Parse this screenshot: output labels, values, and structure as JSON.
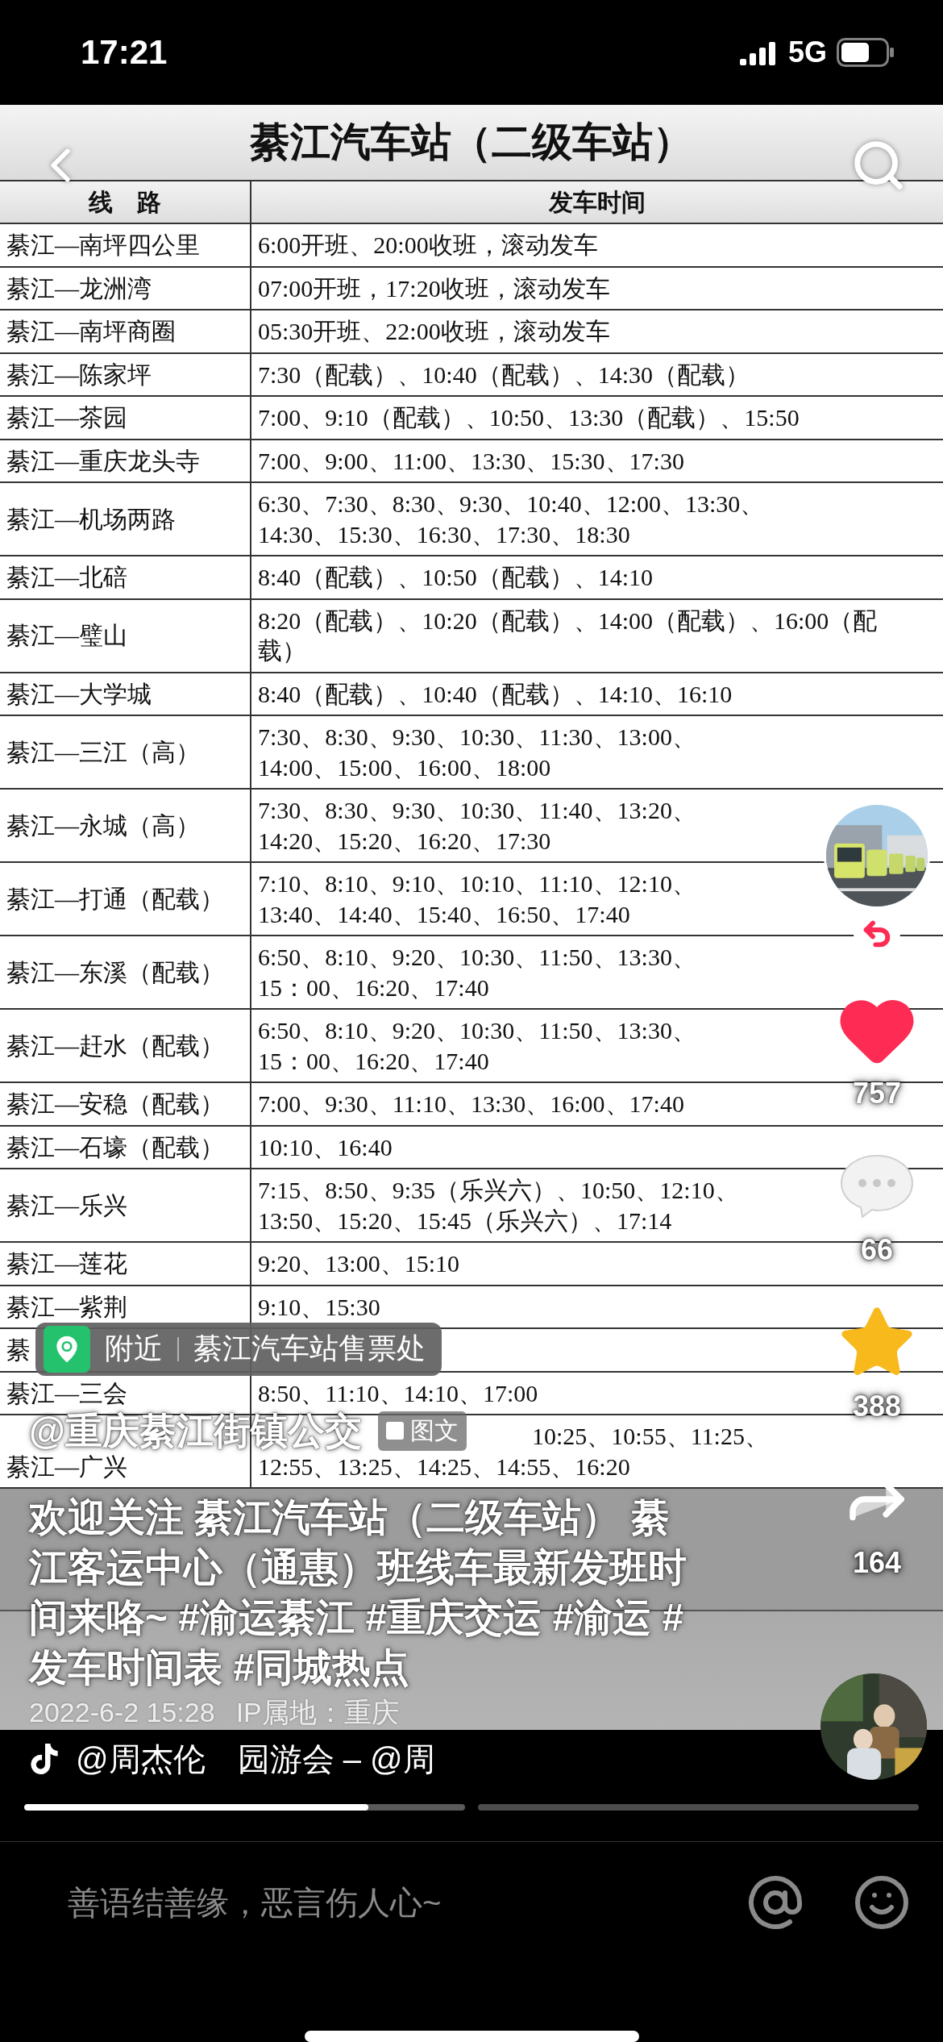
{
  "status_bar": {
    "time": "17:21",
    "network": "5G"
  },
  "post": {
    "title": "綦江汽车站（二级车站）",
    "columns": [
      "线　路",
      "发车时间"
    ],
    "rows": [
      {
        "route": "綦江—南坪四公里",
        "times": [
          "6:00开班、20:00收班，滚动发车"
        ]
      },
      {
        "route": "綦江—龙洲湾",
        "times": [
          "07:00开班，17:20收班，滚动发车"
        ]
      },
      {
        "route": "綦江—南坪商圈",
        "times": [
          "05:30开班、22:00收班，滚动发车"
        ]
      },
      {
        "route": "綦江—陈家坪",
        "times": [
          "7:30（配载）、10:40（配载）、14:30（配载）"
        ]
      },
      {
        "route": "綦江—茶园",
        "times": [
          "7:00、9:10（配载）、10:50、13:30（配载）、15:50"
        ]
      },
      {
        "route": "綦江—重庆龙头寺",
        "times": [
          "7:00、9:00、11:00、13:30、15:30、17:30"
        ]
      },
      {
        "route": "綦江—机场两路",
        "times": [
          "6:30、7:30、8:30、9:30、10:40、12:00、13:30、",
          "14:30、15:30、16:30、17:30、18:30"
        ]
      },
      {
        "route": "綦江—北碚",
        "times": [
          "8:40（配载）、10:50（配载）、14:10"
        ]
      },
      {
        "route": "綦江—璧山",
        "times": [
          "8:20（配载）、10:20（配载）、14:00（配载）、16:00（配",
          "载）"
        ]
      },
      {
        "route": "綦江—大学城",
        "times": [
          "8:40（配载）、10:40（配载）、14:10、16:10"
        ]
      },
      {
        "route": "綦江—三江（高）",
        "times": [
          "7:30、8:30、9:30、10:30、11:30、13:00、",
          "14:00、15:00、16:00、18:00"
        ]
      },
      {
        "route": "綦江—永城（高）",
        "times": [
          "7:30、8:30、9:30、10:30、11:40、13:20、",
          "14:20、15:20、16:20、17:30"
        ]
      },
      {
        "route": "綦江—打通（配载）",
        "times": [
          "7:10、8:10、9:10、10:10、11:10、12:10、",
          "13:40、14:40、15:40、16:50、17:40"
        ]
      },
      {
        "route": "綦江—东溪（配载）",
        "times": [
          "6:50、8:10、9:20、10:30、11:50、13:30、",
          "15：00、16:20、17:40"
        ]
      },
      {
        "route": "綦江—赶水（配载）",
        "times": [
          "6:50、8:10、9:20、10:30、11:50、13:30、",
          "15：00、16:20、17:40"
        ]
      },
      {
        "route": "綦江—安稳（配载）",
        "times": [
          "7:00、9:30、11:10、13:30、16:00、17:40"
        ]
      },
      {
        "route": "綦江—石壕（配载）",
        "times": [
          "10:10、16:40"
        ]
      },
      {
        "route": "綦江—乐兴",
        "times": [
          "7:15、8:50、9:35（乐兴六）、10:50、12:10、",
          "13:50、15:20、15:45（乐兴六）、17:14"
        ]
      },
      {
        "route": "綦江—莲花",
        "times": [
          "9:20、13:00、15:10"
        ]
      },
      {
        "route": "綦江—紫荆",
        "times": [
          "9:10、15:30"
        ]
      },
      {
        "route": "綦"
      },
      {
        "route": "綦江—三会",
        "times": [
          "8:50、11:10、14:10、17:00"
        ]
      },
      {
        "route": "綦江—广兴",
        "kind": "covered",
        "times": [
          "10:25、10:55、11:25、",
          "12:55、13:25、14:25、14:55、16:20"
        ]
      }
    ]
  },
  "nearby": {
    "label": "附近",
    "place": "綦江汽车站售票处"
  },
  "author": {
    "name": "@重庆綦江街镇公交",
    "tag": "图文"
  },
  "caption": "欢迎关注 綦江汽车站（二级车站） 綦江客运中心（通惠）班线车最新发班时间来咯~ #渝运綦江 #重庆交运 #渝运 #发车时间表 #同城热点",
  "meta": {
    "date": "2022-6-2 15:28",
    "ip": "IP属地：重庆"
  },
  "actions": [
    {
      "kind": "like",
      "count": "757",
      "on": true
    },
    {
      "kind": "comment",
      "count": "66"
    },
    {
      "kind": "favorite",
      "count": "388",
      "on": true
    },
    {
      "kind": "share",
      "count": "164"
    }
  ],
  "music": "@周杰伦　园游会 – @周",
  "pages": [
    {
      "selected": true,
      "level": 0.78
    },
    {
      "selected": false
    }
  ],
  "comment_field": {
    "placeholder": "善语结善缘，恶言伤人心~"
  }
}
